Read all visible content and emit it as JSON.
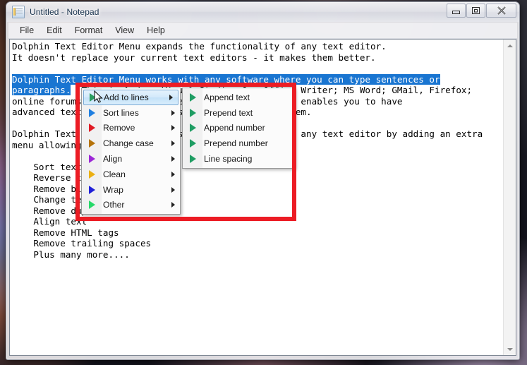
{
  "window": {
    "title": "Untitled - Notepad",
    "app_icon": "notepad-icon",
    "controls": {
      "minimize": "Minimize",
      "maximize": "Restore",
      "close": "Close"
    }
  },
  "menubar": {
    "items": [
      {
        "label": "File"
      },
      {
        "label": "Edit"
      },
      {
        "label": "Format"
      },
      {
        "label": "View"
      },
      {
        "label": "Help"
      }
    ]
  },
  "editor": {
    "lines": [
      {
        "text": "Dolphin Text Editor Menu expands the functionality of any text editor.",
        "selected": false
      },
      {
        "text": "It doesn't replace your current text editors - it makes them better.",
        "selected": false
      },
      {
        "text": "",
        "selected": false
      },
      {
        "text": "Dolphin Text Editor Menu works with any software where you can type sentences or",
        "selected": true
      },
      {
        "text": "paragraphs.",
        "selected": true,
        "tail": "  This includes: Visual Studio; OpenOffice Writer; MS Word; GMail, Firefox;"
      },
      {
        "text": "online forums; email clients; text editors; etc. This enables you to have",
        "selected": false
      },
      {
        "text": "advanced text manipulation tools wherever you need them.",
        "selected": false
      },
      {
        "text": "",
        "selected": false
      },
      {
        "text": "Dolphin Text Editor Menu expands the functionality of any text editor by adding an extra",
        "selected": false
      },
      {
        "text": "menu allowing you to:",
        "selected": false
      },
      {
        "text": "",
        "selected": false
      },
      {
        "text": "    Sort text",
        "selected": false
      },
      {
        "text": "    Reverse text",
        "selected": false
      },
      {
        "text": "    Remove blank lines",
        "selected": false
      },
      {
        "text": "    Change text case",
        "selected": false
      },
      {
        "text": "    Remove duplicate lines",
        "selected": false
      },
      {
        "text": "    Align text",
        "selected": false
      },
      {
        "text": "    Remove HTML tags",
        "selected": false
      },
      {
        "text": "    Remove trailing spaces",
        "selected": false
      },
      {
        "text": "    Plus many more....",
        "selected": false
      }
    ]
  },
  "context_menu": {
    "items": [
      {
        "label": "Add to lines",
        "arrow_color": "#2b9e5f",
        "highlighted": true,
        "has_submenu": true
      },
      {
        "label": "Sort lines",
        "arrow_color": "#1f7fe0",
        "highlighted": false,
        "has_submenu": true
      },
      {
        "label": "Remove",
        "arrow_color": "#e01b24",
        "highlighted": false,
        "has_submenu": true
      },
      {
        "label": "Change case",
        "arrow_color": "#b5730a",
        "highlighted": false,
        "has_submenu": true
      },
      {
        "label": "Align",
        "arrow_color": "#9c27d6",
        "highlighted": false,
        "has_submenu": true
      },
      {
        "label": "Clean",
        "arrow_color": "#ebb013",
        "highlighted": false,
        "has_submenu": true
      },
      {
        "label": "Wrap",
        "arrow_color": "#2020d8",
        "highlighted": false,
        "has_submenu": true
      },
      {
        "label": "Other",
        "arrow_color": "#27d96a",
        "highlighted": false,
        "has_submenu": true
      }
    ]
  },
  "submenu": {
    "parent": "Add to lines",
    "items": [
      {
        "label": "Append text",
        "arrow_color": "#1f9d63"
      },
      {
        "label": "Prepend text",
        "arrow_color": "#1f9d63"
      },
      {
        "label": "Append number",
        "arrow_color": "#1f9d63"
      },
      {
        "label": "Prepend number",
        "arrow_color": "#1f9d63"
      },
      {
        "label": "Line spacing",
        "arrow_color": "#1f9d63"
      }
    ]
  },
  "annotation": {
    "shape": "rectangle",
    "color": "#ec1c24"
  },
  "scrollbar": {
    "up_arrow": "scroll-up-icon",
    "down_arrow": "scroll-down-icon"
  },
  "colors": {
    "selection": "#1975d1",
    "menu_highlight": "#c3e1f8",
    "annotation_red": "#ec1c24"
  }
}
